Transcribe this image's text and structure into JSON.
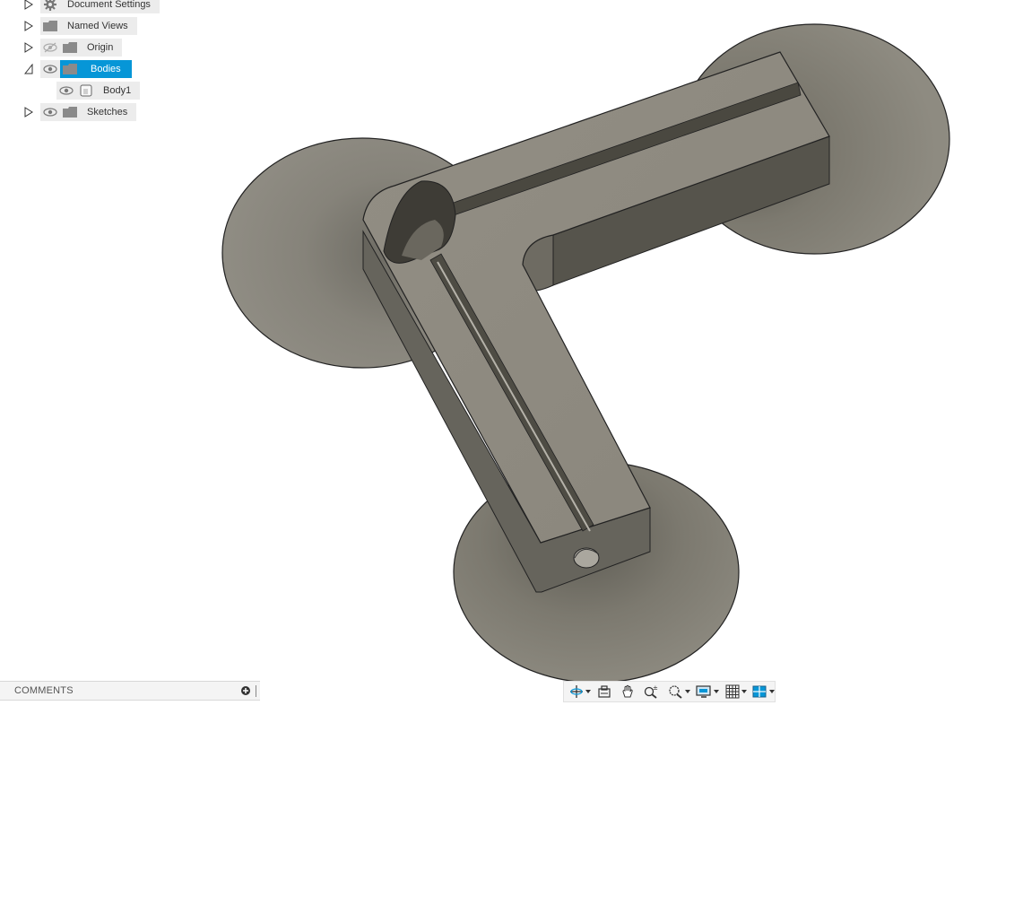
{
  "browser": {
    "items": [
      {
        "label": "Document Settings",
        "icon": "gear-icon",
        "expanded": false
      },
      {
        "label": "Named Views",
        "icon": "folder-icon",
        "expanded": false
      },
      {
        "label": "Origin",
        "icon": "folder-icon",
        "visibility": "hidden",
        "expanded": false
      },
      {
        "label": "Bodies",
        "icon": "folder-icon",
        "visibility": "visible",
        "expanded": true,
        "selected": true
      },
      {
        "label": "Body1",
        "icon": "body-icon",
        "visibility": "visible"
      },
      {
        "label": "Sketches",
        "icon": "folder-icon",
        "visibility": "visible",
        "expanded": false
      }
    ]
  },
  "comments": {
    "title": "COMMENTS"
  },
  "navbar": {
    "tools": [
      "orbit-icon",
      "look-at-icon",
      "pan-icon",
      "zoom-icon",
      "fit-icon",
      "display-settings-icon",
      "grid-icon",
      "viewports-icon"
    ]
  },
  "colors": {
    "selection": "#0696d7",
    "model_face": "#8c887e",
    "model_dark": "#5c5a52"
  }
}
